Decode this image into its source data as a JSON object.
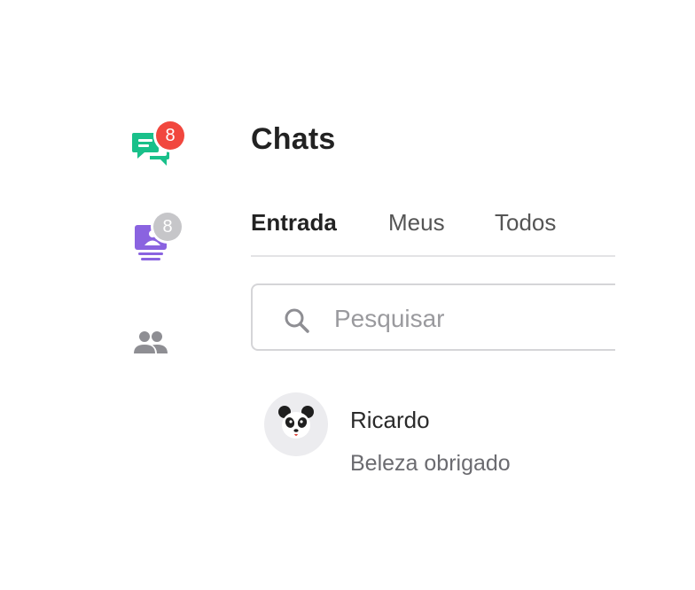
{
  "sidebar": {
    "chats_badge": "8",
    "contacts_badge": "8",
    "colors": {
      "chats_icon": "#19c08a",
      "contacts_icon": "#8a63e0",
      "team_icon": "#8e8e93",
      "badge_red": "#f1473e",
      "badge_grey": "#c6c6c9"
    },
    "icons": [
      "chat-bubbles-icon",
      "contacts-book-icon",
      "team-icon"
    ]
  },
  "header": {
    "title": "Chats"
  },
  "tabs": [
    {
      "label": "Entrada",
      "active": true
    },
    {
      "label": "Meus",
      "active": false
    },
    {
      "label": "Todos",
      "active": false
    }
  ],
  "search": {
    "placeholder": "Pesquisar",
    "value": ""
  },
  "conversations": [
    {
      "name": "Ricardo",
      "last_message": "Beleza obrigado",
      "avatar_icon": "panda-avatar"
    }
  ]
}
